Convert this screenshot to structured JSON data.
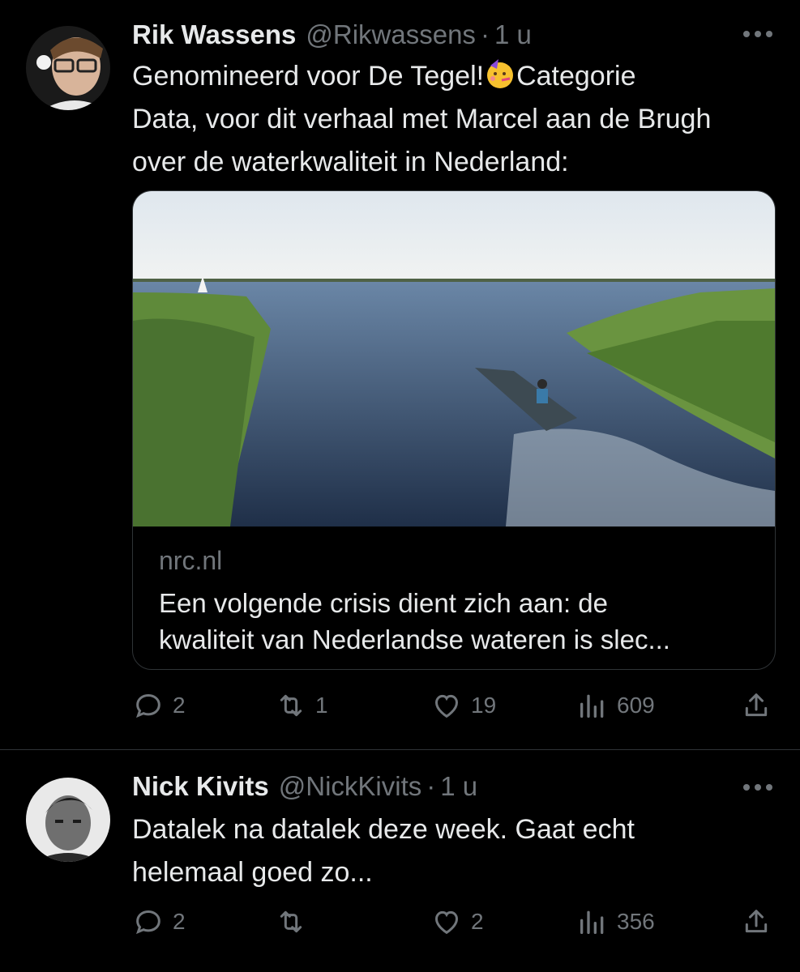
{
  "tweets": [
    {
      "name": "Rik Wassens",
      "handle": "@Rikwassens",
      "separator": "·",
      "time": "1 u",
      "text_line1_a": "Genomineerd voor De Tegel!",
      "text_line1_b": "Categorie",
      "text_line2": "Data, voor dit verhaal met Marcel aan de Brugh",
      "text_line3": "over de waterkwaliteit in Nederland:",
      "emoji": "partying-face-emoji",
      "card": {
        "domain": "nrc.nl",
        "title_line1": "Een volgende crisis dient zich aan: de",
        "title_line2": "kwaliteit van Nederlandse wateren is slec..."
      },
      "stats": {
        "replies": "2",
        "retweets": "1",
        "likes": "19",
        "views": "609"
      }
    },
    {
      "name": "Nick Kivits",
      "handle": "@NickKivits",
      "separator": "·",
      "time": "1 u",
      "text_line1": "Datalek na datalek deze week. Gaat echt",
      "text_line2": "helemaal goed zo...",
      "stats": {
        "replies": "2",
        "retweets": "",
        "likes": "2",
        "views": "356"
      }
    }
  ],
  "colors": {
    "background": "#000000",
    "text": "#e7e9ea",
    "muted": "#71767b",
    "border": "#2f3336"
  }
}
